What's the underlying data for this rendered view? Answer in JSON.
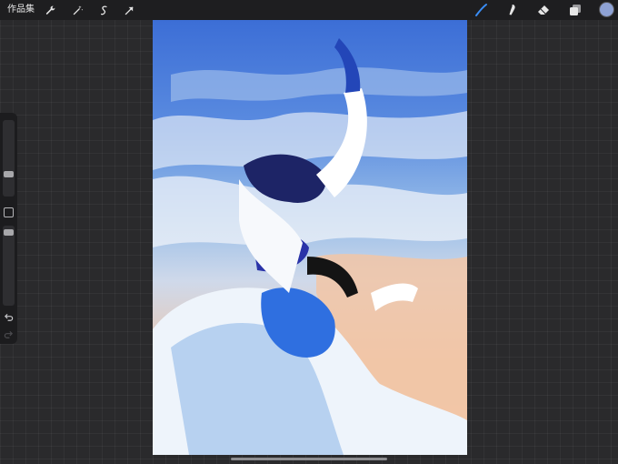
{
  "topbar": {
    "gallery_label": "作品集",
    "left_tools": [
      "wrench-icon",
      "magic-wand-icon",
      "selection-icon",
      "transform-arrow-icon"
    ],
    "right_tools": [
      "brush-icon",
      "smudge-icon",
      "eraser-icon",
      "layers-icon"
    ],
    "active_tool": "brush-icon",
    "active_color": "#8ea2d4",
    "accent": "#3a8df5"
  },
  "sidebar": {
    "controls": [
      "brush-size-slider",
      "modify-button",
      "opacity-slider",
      "undo-icon",
      "redo-icon"
    ]
  },
  "canvas": {
    "artwork": "painting"
  }
}
